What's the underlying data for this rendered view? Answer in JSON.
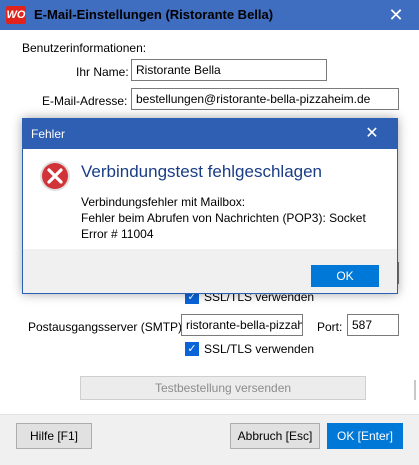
{
  "window": {
    "logo_text": "WO",
    "title": "E-Mail-Einstellungen (Ristorante Bella)",
    "close_glyph": "✕"
  },
  "form": {
    "section_label": "Benutzerinformationen:",
    "name_label": "Ihr Name:",
    "name_value": "Ristorante Bella",
    "email_label": "E-Mail-Adresse:",
    "email_value": "bestellungen@ristorante-bella-pizzaheim.de",
    "ssl_label_1": "SSL/TLS verwenden",
    "smtp_label": "Postausgangsserver (SMTP):",
    "smtp_value": "ristorante-bella-pizzaheim.de",
    "port_label": "Port:",
    "port_value": "587",
    "ssl_label_2": "SSL/TLS verwenden",
    "test_button": "Testbestellung versenden"
  },
  "footer": {
    "help_button": "Hilfe [F1]",
    "cancel_button": "Abbruch [Esc]",
    "ok_button": "OK [Enter]"
  },
  "error_dialog": {
    "title": "Fehler",
    "close_glyph": "✕",
    "heading": "Verbindungstest fehlgeschlagen",
    "message_line1": "Verbindungsfehler mit Mailbox:",
    "message_line2": "Fehler beim Abrufen von Nachrichten (POP3): Socket",
    "message_line3": "Error # 11004",
    "ok_button": "OK",
    "icon": "error-icon"
  },
  "colors": {
    "title_bar": "#3f6dbf",
    "accent": "#0078d7",
    "error": "#d13438"
  }
}
